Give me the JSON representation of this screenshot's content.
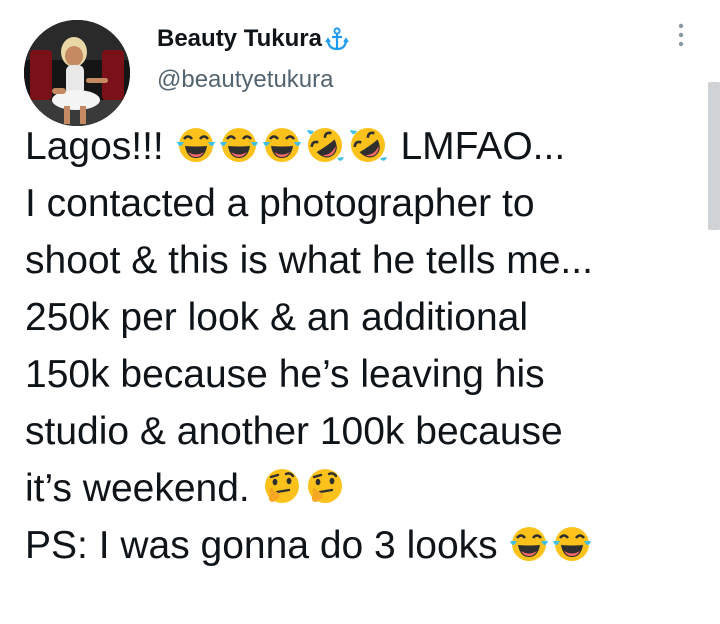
{
  "tweet": {
    "author_name": "Beauty Tukura",
    "verified_icon": "anchor-icon",
    "handle": "@beautyetukura",
    "more_icon": "more-vertical-icon",
    "text": {
      "line1_start": "Lagos!!!",
      "line1_emojis": [
        "tears-of-joy-emoji",
        "tears-of-joy-emoji",
        "tears-of-joy-emoji",
        "rolling-on-floor-laughing-emoji",
        "rolling-on-floor-laughing-emoji"
      ],
      "line1_end": "LMFAO...",
      "line2": "I contacted a photographer to",
      "line3": "shoot & this is what he tells me...",
      "line4": "250k per look & an additional",
      "line5": "150k because he’s leaving his",
      "line6": "studio & another 100k because",
      "line7": "it’s weekend.",
      "line7_emojis": [
        "thinking-face-emoji",
        "thinking-face-emoji"
      ],
      "line8": "PS: I was gonna do 3 looks",
      "line8_emojis": [
        "tears-of-joy-emoji",
        "tears-of-joy-emoji"
      ]
    }
  },
  "colors": {
    "text": "#0f1419",
    "secondary_text": "#536471",
    "anchor": "#1d9bf0",
    "emoji_face": "#fcc21b",
    "emoji_tear": "#40c0e7"
  }
}
